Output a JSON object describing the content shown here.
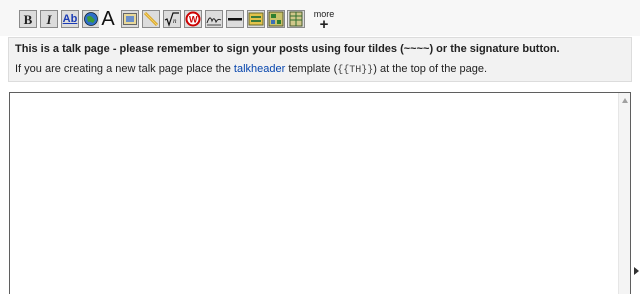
{
  "toolbar": {
    "bold_glyph": "B",
    "italic_glyph": "I",
    "link_glyph": "Ab",
    "headline_glyph": "A",
    "more_label": "more",
    "more_plus": "+"
  },
  "notice": {
    "line1": "This is a talk page - please remember to sign your posts using four tildes (~~~~) or the signature button.",
    "line2_prefix": "If you are creating a new talk page place the ",
    "line2_link": "talkheader",
    "line2_middle": " template (",
    "line2_code": "{{TH}}",
    "line2_suffix": ") at the top of the page."
  },
  "editor": {
    "content": ""
  }
}
